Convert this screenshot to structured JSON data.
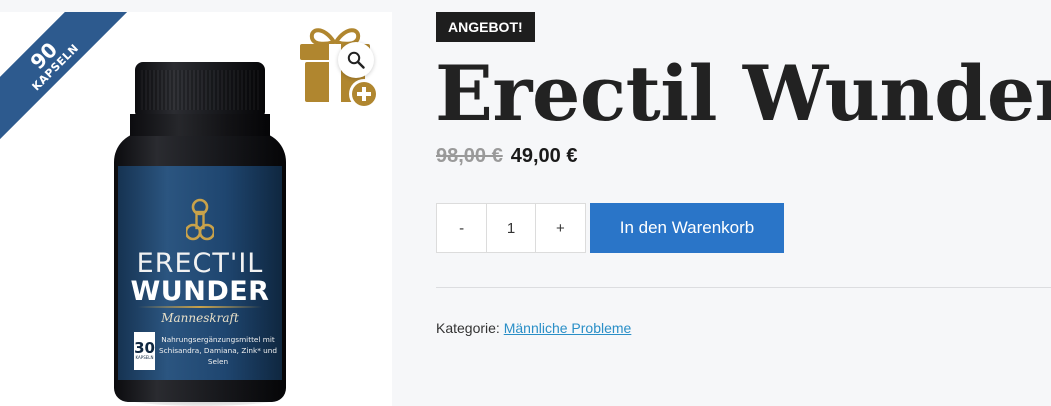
{
  "gallery": {
    "ribbon": {
      "number": "90",
      "unit": "KAPSELN",
      "color": "#2d5a8e"
    },
    "product_image": {
      "brand_line1": "ERECT'IL",
      "brand_line2": "WUNDER",
      "tagline": "Manneskraft",
      "count_number": "30",
      "count_unit": "KAPSELN",
      "description": "Nahrungsergänzungsmittel mit Schisandra, Damiana, Zink* und Selen"
    },
    "gift_icon": "gift-plus-icon",
    "zoom_icon": "magnifier-icon"
  },
  "product": {
    "badge": "ANGEBOT!",
    "title": "Erectil Wunder",
    "old_price": "98,00 €",
    "new_price": "49,00 €",
    "quantity": {
      "minus_label": "-",
      "value": "1",
      "plus_label": "+"
    },
    "add_to_cart_label": "In den Warenkorb",
    "category_label": "Kategorie:",
    "category_link": "Männliche Probleme"
  },
  "colors": {
    "accent": "#2a75c8",
    "link": "#2a8fc7",
    "gold": "#b0862f",
    "badge_bg": "#1e1e1e"
  }
}
